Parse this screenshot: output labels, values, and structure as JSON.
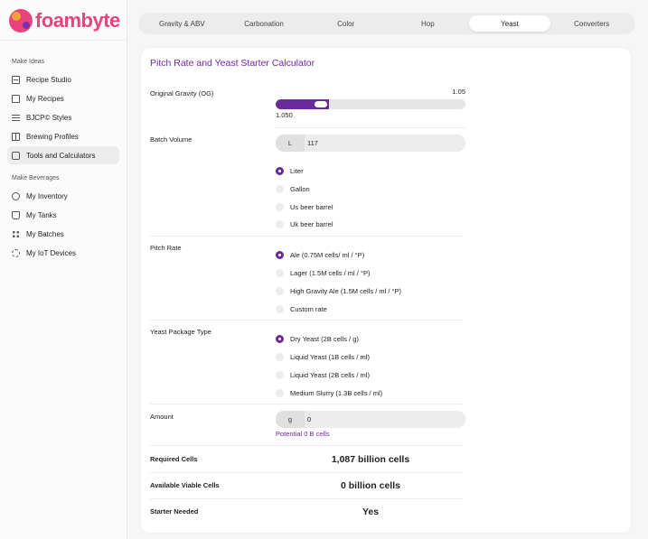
{
  "brand": {
    "name": "foambyte"
  },
  "sidebar": {
    "sections": [
      {
        "label": "Make Ideas"
      },
      {
        "label": "Make Beverages"
      }
    ],
    "items": [
      {
        "label": "Recipe Studio",
        "icon": "recipe-icon"
      },
      {
        "label": "My Recipes",
        "icon": "recipes-icon"
      },
      {
        "label": "BJCP© Styles",
        "icon": "styles-list-icon"
      },
      {
        "label": "Brewing Profiles",
        "icon": "profiles-icon"
      },
      {
        "label": "Tools and Calculators",
        "icon": "tools-icon",
        "active": true
      },
      {
        "label": "My Inventory",
        "icon": "inventory-icon"
      },
      {
        "label": "My Tanks",
        "icon": "tanks-icon"
      },
      {
        "label": "My Batches",
        "icon": "batches-icon"
      },
      {
        "label": "My IoT Devices",
        "icon": "iot-icon"
      }
    ]
  },
  "tabs": [
    {
      "label": "Gravity & ABV"
    },
    {
      "label": "Carbonation"
    },
    {
      "label": "Color"
    },
    {
      "label": "Hop"
    },
    {
      "label": "Yeast",
      "active": true
    },
    {
      "label": "Converters"
    }
  ],
  "calculator": {
    "title": "Pitch Rate and Yeast Starter Calculator",
    "og": {
      "label": "Original Gravity (OG)",
      "max_label": "1.05",
      "value": "1.050",
      "fill_fraction": 0.28
    },
    "batch_volume": {
      "label": "Batch Volume",
      "unit": "L",
      "value": "117",
      "options": [
        "Liter",
        "Gallon",
        "Us beer barrel",
        "Uk beer barrel"
      ],
      "selected": 0
    },
    "pitch_rate": {
      "label": "Pitch Rate",
      "options": [
        "Ale (0.75M cells/ ml / °P)",
        "Lager (1.5M cells / ml / °P)",
        "High Gravity Ale (1.5M cells / ml / °P)",
        "Custom rate"
      ],
      "selected": 0
    },
    "yeast_package": {
      "label": "Yeast Package Type",
      "options": [
        "Dry Yeast (2B cells / g)",
        "Liquid Yeast (1B cells / ml)",
        "Liquid Yeast (2B cells / ml)",
        "Medium Slurry (1.3B cells / ml)"
      ],
      "selected": 0
    },
    "amount": {
      "label": "Amount",
      "unit": "g",
      "value": "0",
      "potential": "Potential 0 B cells"
    },
    "results": [
      {
        "label": "Required Cells",
        "value": "1,087 billion cells"
      },
      {
        "label": "Available Viable Cells",
        "value": "0 billion cells"
      },
      {
        "label": "Starter Needed",
        "value": "Yes"
      }
    ]
  }
}
